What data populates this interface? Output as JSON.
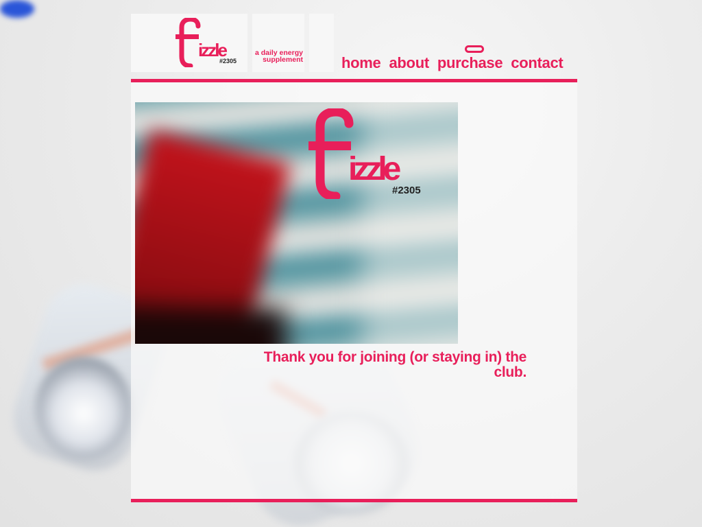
{
  "brand": {
    "logo_word": "izzle",
    "logo_letter": "f",
    "logo_number": "#2305",
    "tagline": "a daily energy supplement"
  },
  "nav": {
    "items": [
      {
        "label": "home"
      },
      {
        "label": "about"
      },
      {
        "label": "purchase"
      },
      {
        "label": "contact"
      }
    ]
  },
  "hero": {
    "logo_word": "izzle",
    "logo_letter": "f",
    "logo_number": "#2305"
  },
  "message": {
    "text": "Thank you for joining (or staying in) the club."
  },
  "colors": {
    "accent": "#e81f5a",
    "panel": "#f7f7f7"
  },
  "icons": {
    "nav_indicator": "pill-indicator-icon"
  }
}
